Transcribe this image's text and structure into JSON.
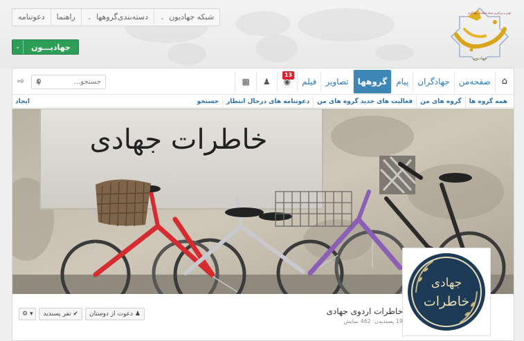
{
  "top_nav": {
    "items": [
      {
        "label": "شبکه جهادیون",
        "caret": "⌄"
      },
      {
        "label": "دسته‌بندی‌گروهها",
        "caret": "⌄"
      },
      {
        "label": "راهنما",
        "caret": ""
      },
      {
        "label": "دعوتنامه",
        "caret": ""
      }
    ]
  },
  "site_button": {
    "label": "جهادیـــون",
    "chevron": "⌄"
  },
  "logo": {
    "tagline": "اولین و بزرگترین شبکه اجتماعی جهادگران",
    "wordmark": "جهادیون"
  },
  "main_nav": {
    "home_icon": "home-icon",
    "tabs": [
      "صفحه‌من",
      "جهادگران",
      "پیام",
      "گروهها",
      "تصاویر",
      "فیلم"
    ],
    "active_tab": "گروهها",
    "notification_count": "13",
    "search_placeholder": "جستجو..."
  },
  "sub_nav": {
    "items": [
      "همه گروه ها",
      "گروه های من",
      "فعالیت های جدید گروه های من",
      "دعوتنامه های درحال انتظار",
      "جستجو"
    ],
    "create_label": "ایجاد"
  },
  "cover": {
    "sign_text": "خاطرات جهادی"
  },
  "group": {
    "name": "خاطرات اردوی جهادی",
    "stats": "19 پسندیدن· 462 نمایش",
    "avatar_text_1": "خاطرات",
    "avatar_text_2": "جهادی"
  },
  "actions": {
    "invite_label": "دعوت از دوستان",
    "like_label": "نفر پسندید",
    "gear_caret": "▾"
  },
  "colors": {
    "active_tab": "#3d86b5",
    "site_button": "#2e9e57",
    "badge": "#d9232d",
    "link": "#2a7ab8"
  }
}
